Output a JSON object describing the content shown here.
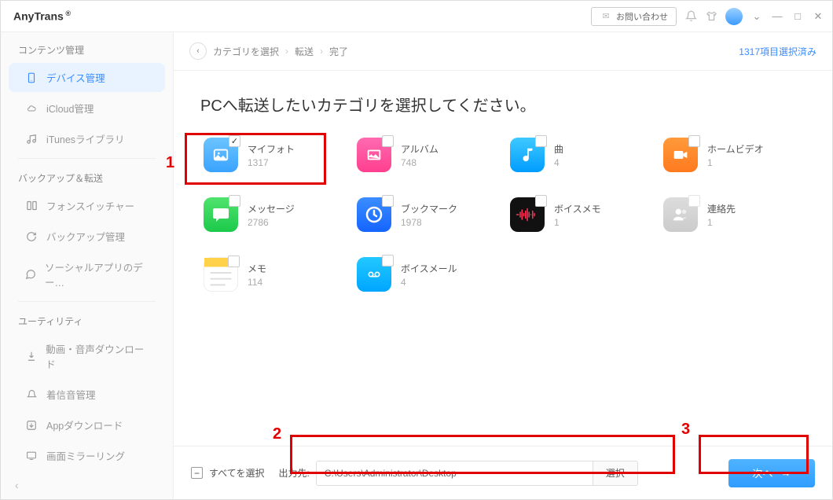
{
  "app_name": "AnyTrans",
  "titlebar": {
    "contact_label": "お問い合わせ"
  },
  "sidebar": {
    "section1": "コンテンツ管理",
    "items1": [
      {
        "label": "デバイス管理"
      },
      {
        "label": "iCloud管理"
      },
      {
        "label": "iTunesライブラリ"
      }
    ],
    "section2": "バックアップ＆転送",
    "items2": [
      {
        "label": "フォンスイッチャー"
      },
      {
        "label": "バックアップ管理"
      },
      {
        "label": "ソーシャルアプリのデー…"
      }
    ],
    "section3": "ユーティリティ",
    "items3": [
      {
        "label": "動画・音声ダウンロード"
      },
      {
        "label": "着信音管理"
      },
      {
        "label": "Appダウンロード"
      },
      {
        "label": "画面ミラーリング"
      }
    ]
  },
  "breadcrumb": {
    "a": "カテゴリを選択",
    "b": "転送",
    "c": "完了"
  },
  "selcount": "1317項目選択済み",
  "page_title": "PCへ転送したいカテゴリを選択してください。",
  "cats": [
    {
      "name": "マイフォト",
      "count": "1317",
      "checked": true
    },
    {
      "name": "アルバム",
      "count": "748"
    },
    {
      "name": "曲",
      "count": "4"
    },
    {
      "name": "ホームビデオ",
      "count": "1"
    },
    {
      "name": "メッセージ",
      "count": "2786"
    },
    {
      "name": "ブックマーク",
      "count": "1978"
    },
    {
      "name": "ボイスメモ",
      "count": "1"
    },
    {
      "name": "連絡先",
      "count": "1",
      "disabled": true
    },
    {
      "name": "メモ",
      "count": "114"
    },
    {
      "name": "ボイスメール",
      "count": "4"
    }
  ],
  "footer": {
    "select_all": "すべてを選択",
    "out_label": "出力先:",
    "out_path": "C:\\Users\\Administrator\\Desktop",
    "browse": "選択",
    "next": "次へ"
  },
  "annotations": {
    "n1": "1",
    "n2": "2",
    "n3": "3"
  }
}
